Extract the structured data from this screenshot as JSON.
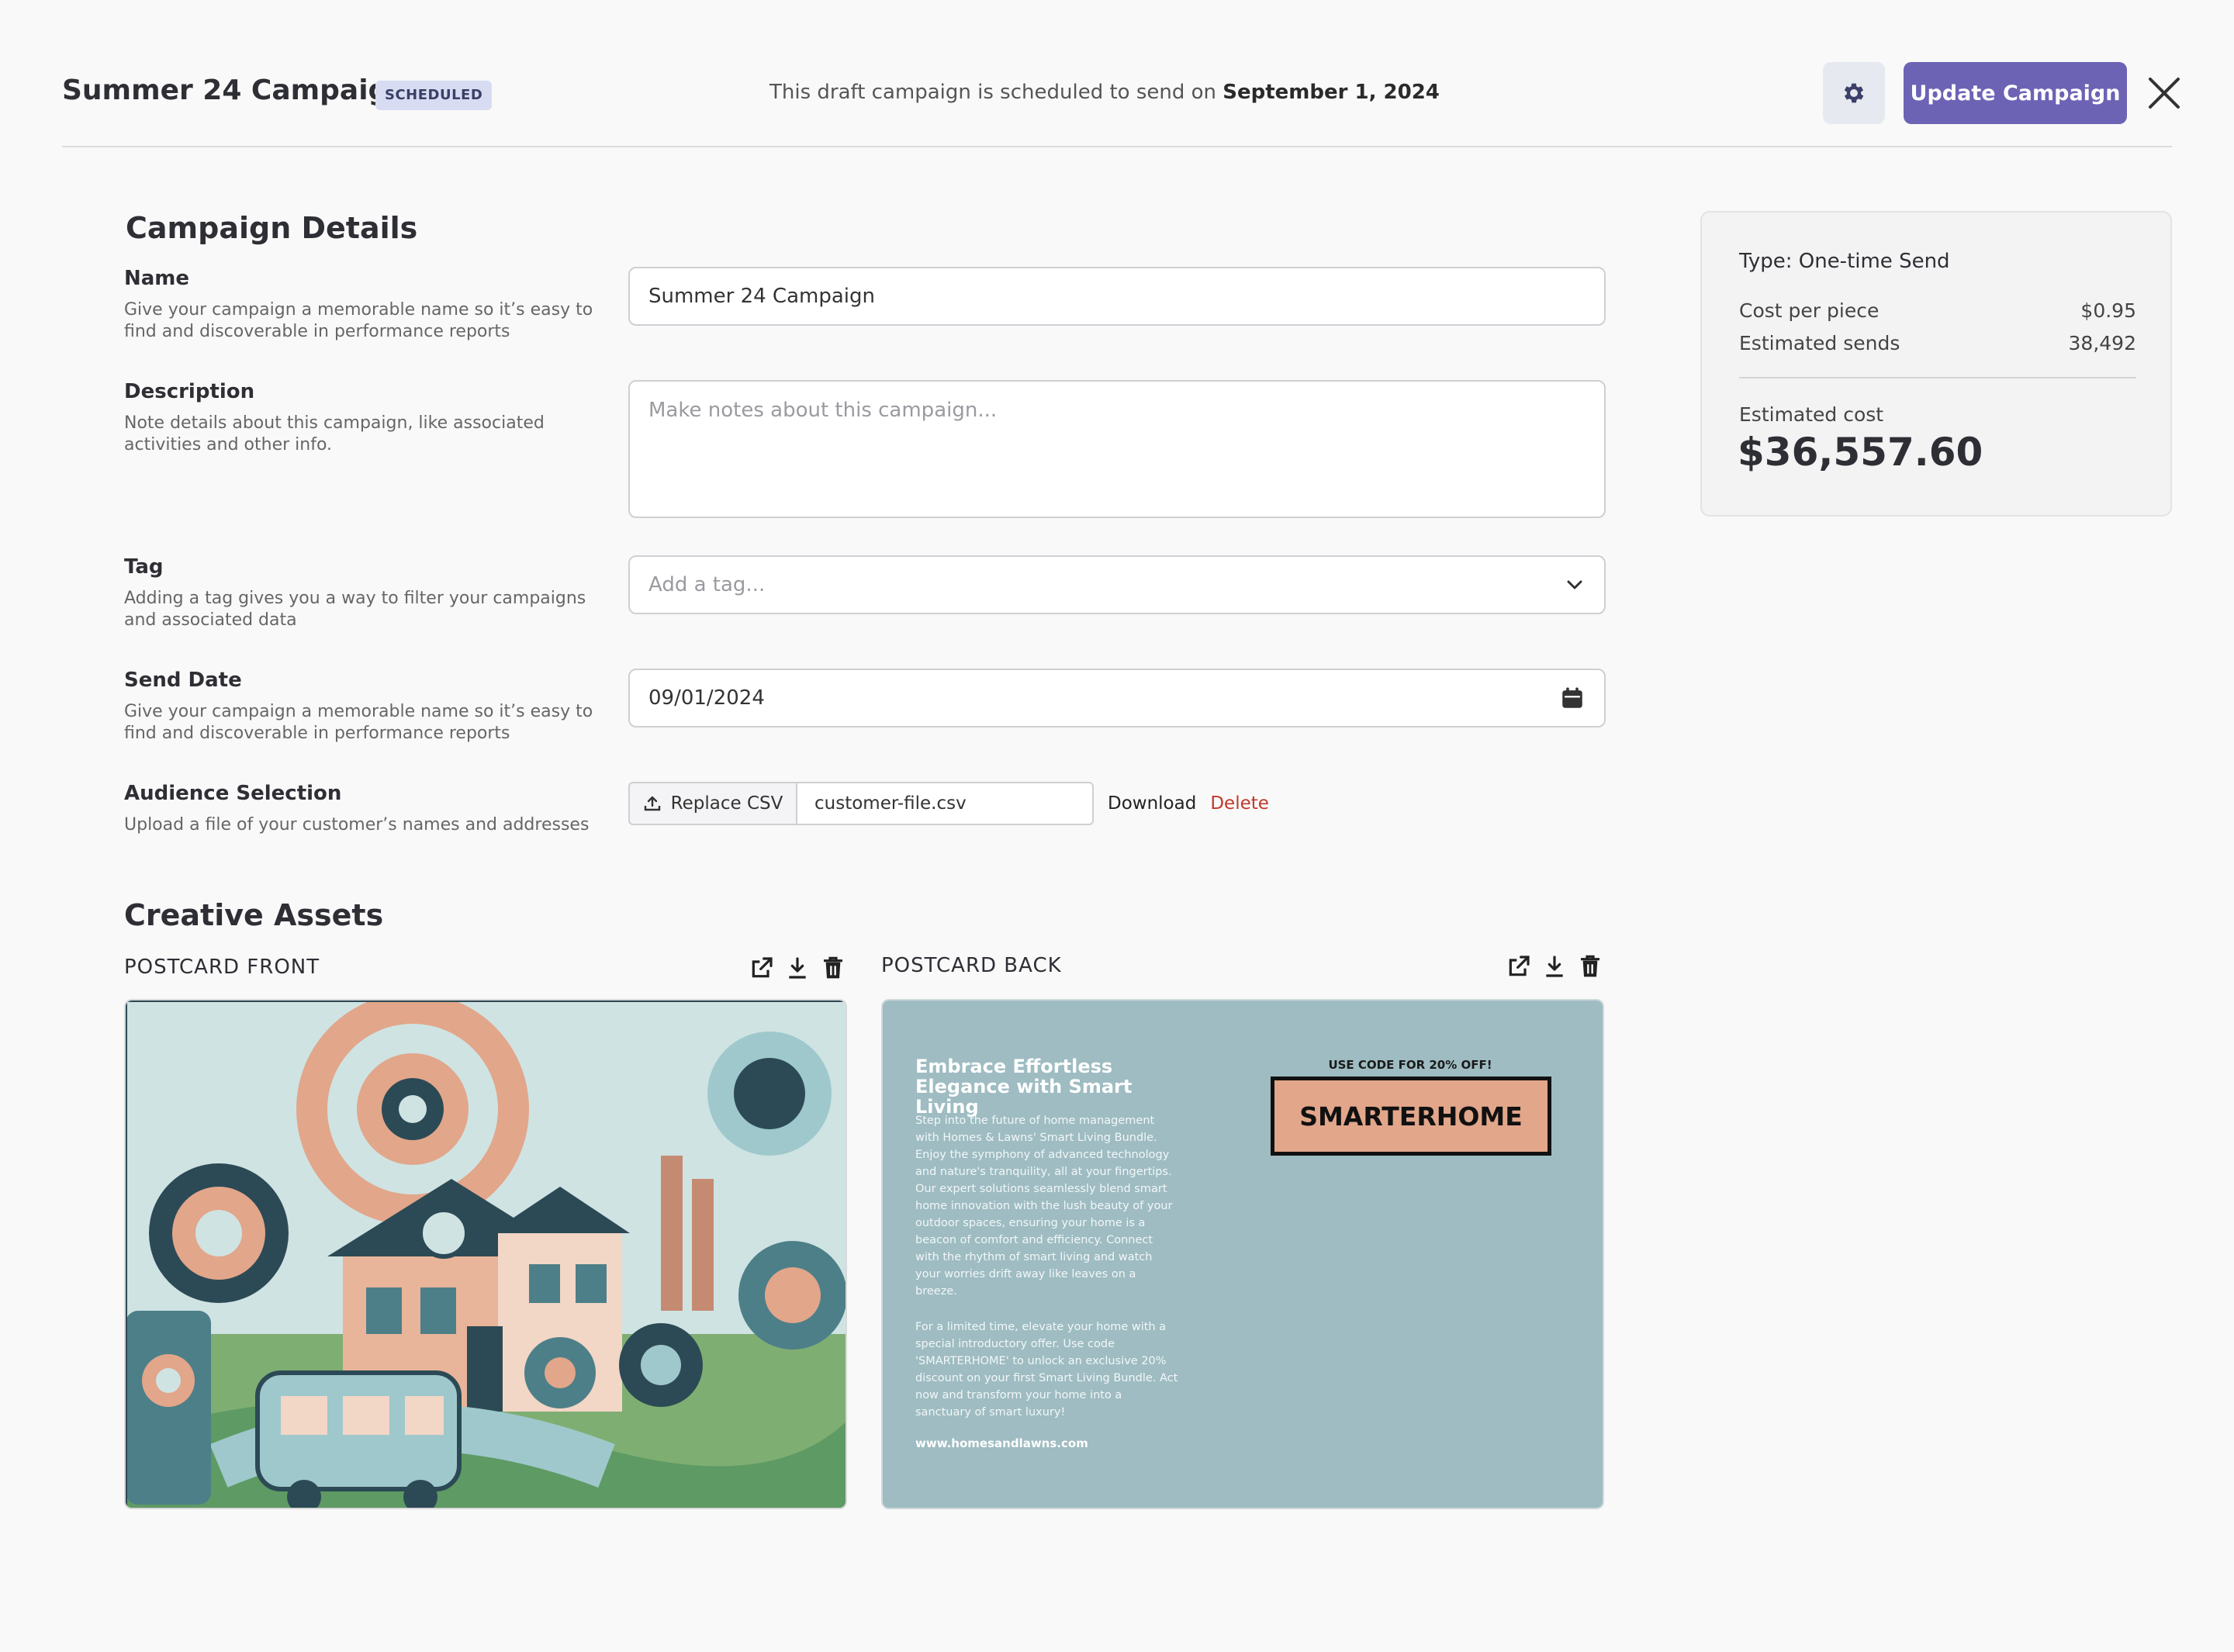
{
  "header": {
    "title": "Summer 24 Campaign",
    "status": "SCHEDULED",
    "schedule_prefix": "This draft campaign is scheduled to send on ",
    "schedule_date": "September 1, 2024",
    "update_label": "Update Campaign",
    "accent_color": "#6c63b5"
  },
  "details": {
    "section_title": "Campaign Details",
    "name": {
      "label": "Name",
      "help": "Give your campaign a memorable name so it’s easy to find and discoverable in performance reports",
      "value": "Summer 24 Campaign"
    },
    "description": {
      "label": "Description",
      "help": "Note details about this campaign, like associated activities and other info.",
      "placeholder": "Make notes about this campaign..."
    },
    "tag": {
      "label": "Tag",
      "help": "Adding a tag gives you a way to filter your campaigns and associated data",
      "placeholder": "Add a tag..."
    },
    "send_date": {
      "label": "Send Date",
      "help": "Give your campaign a memorable name so it’s easy to find and discoverable in performance reports",
      "value": "09/01/2024"
    },
    "audience": {
      "label": "Audience Selection",
      "help": "Upload a file of your customer’s names and addresses",
      "replace_label": "Replace CSV",
      "file_name": "customer-file.csv",
      "download_label": "Download",
      "delete_label": "Delete"
    }
  },
  "summary": {
    "type_label": "Type: One-time Send",
    "cost_per_piece_label": "Cost per piece",
    "cost_per_piece": "$0.95",
    "estimated_sends_label": "Estimated sends",
    "estimated_sends": "38,492",
    "estimated_cost_label": "Estimated cost",
    "estimated_cost": "$36,557.60"
  },
  "assets": {
    "section_title": "Creative Assets",
    "front_label": "POSTCARD FRONT",
    "back_label": "POSTCARD BACK",
    "back": {
      "headline": "Embrace Effortless Elegance with Smart Living",
      "body1": "Step into the future of home management with Homes & Lawns' Smart Living Bundle. Enjoy the symphony of advanced technology and nature's tranquility, all at your fingertips. Our expert solutions seamlessly blend smart home innovation with the lush beauty of your outdoor spaces, ensuring your home is a beacon of comfort and efficiency. Connect with the rhythm of smart living and watch your worries drift away like leaves on a breeze.",
      "body2": "For a limited time, elevate your home with a special introductory offer. Use code 'SMARTERHOME' to unlock an exclusive 20% discount on your first Smart Living Bundle. Act now and transform your home into a sanctuary of smart luxury!",
      "url": "www.homesandlawns.com",
      "promo_caption": "USE CODE FOR 20% OFF!",
      "promo_code": "SMARTERHOME"
    }
  }
}
